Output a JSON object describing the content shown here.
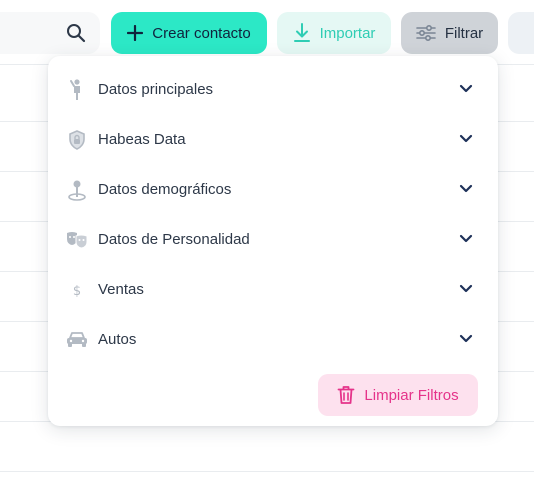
{
  "toolbar": {
    "search_icon": "search-icon",
    "create_label": "Crear contacto",
    "import_label": "Importar",
    "filter_label": "Filtrar"
  },
  "filter_menu": {
    "items": [
      {
        "label": "Datos principales",
        "icon": "person-icon"
      },
      {
        "label": "Habeas Data",
        "icon": "shield-lock-icon"
      },
      {
        "label": "Datos demográficos",
        "icon": "location-pin-icon"
      },
      {
        "label": "Datos de Personalidad",
        "icon": "theater-masks-icon"
      },
      {
        "label": "Ventas",
        "icon": "dollar-icon"
      },
      {
        "label": "Autos",
        "icon": "car-icon"
      }
    ],
    "clear_label": "Limpiar Filtros"
  },
  "colors": {
    "primary": "#2ce8c6",
    "primary_light": "#e5f8f4",
    "filter_active": "#cfd3d8",
    "danger": "#e5338a",
    "danger_light": "#fde1ee",
    "text": "#2d3848",
    "icon_muted": "#b3bac3",
    "chevron": "#1e3159"
  }
}
